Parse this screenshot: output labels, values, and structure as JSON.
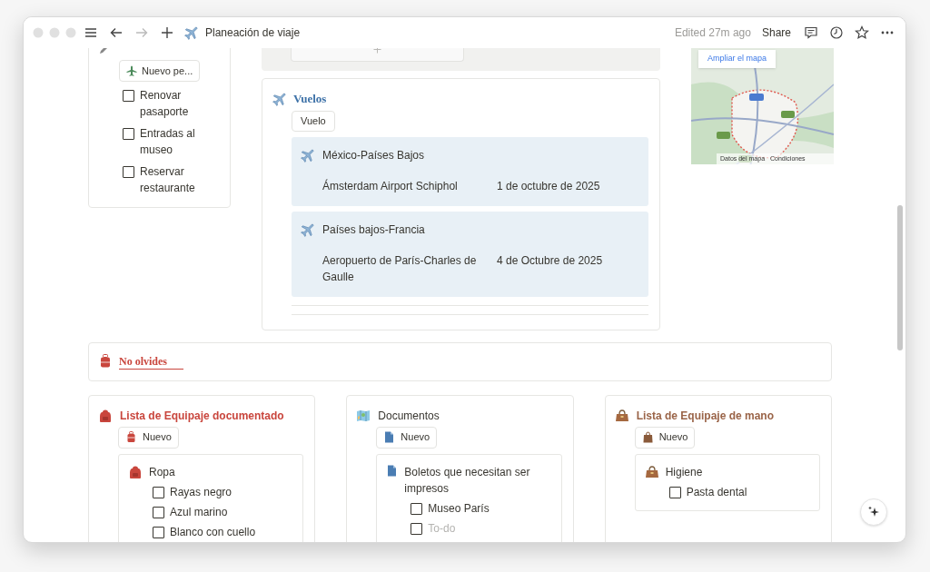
{
  "topbar": {
    "title": "Planeación de viaje",
    "edited": "Edited 27m ago",
    "share": "Share"
  },
  "pending": {
    "button": "Nuevo pe...",
    "todos": [
      {
        "text": "Renovar pasaporte",
        "checked": false
      },
      {
        "text": "Entradas al museo",
        "checked": false
      },
      {
        "text": "Reservar restaurante",
        "checked": false
      }
    ]
  },
  "flights": {
    "title": "Vuelos",
    "button": "Vuelo",
    "items": [
      {
        "title": "México-Países Bajos",
        "airport": "Ámsterdam Airport Schiphol",
        "date": "1 de octubre de 2025"
      },
      {
        "title": "Países bajos-Francia",
        "airport": "Aeropuerto de París-Charles de Gaulle",
        "date": "4 de Octubre de 2025"
      }
    ]
  },
  "map": {
    "kind": "picture",
    "expand_link": "Ampliar el mapa",
    "attribution": [
      "Datos del mapa",
      "Condiciones"
    ]
  },
  "reminder": {
    "title": "No olvides"
  },
  "lists": [
    {
      "kind": "luggage",
      "title": "Lista de Equipaje documentado",
      "color": "#c9463d",
      "button": "Nuevo",
      "groups": [
        {
          "title": "Ropa",
          "todos": [
            {
              "text": "Rayas negro",
              "checked": false
            },
            {
              "text": "Azul marino",
              "checked": false
            },
            {
              "text": "Blanco con cuello",
              "checked": false
            }
          ]
        }
      ]
    },
    {
      "kind": "documents",
      "title": "Documentos",
      "color": "#37352f",
      "button": "Nuevo",
      "groups": [
        {
          "title": "Boletos que necesitan ser impresos",
          "todos": [
            {
              "text": "Museo París",
              "checked": false
            },
            {
              "placeholder": "To-do",
              "checked": false
            }
          ]
        }
      ]
    },
    {
      "kind": "handbag",
      "title": "Lista de Equipaje de mano",
      "color": "#9a6448",
      "button": "Nuevo",
      "groups": [
        {
          "title": "Higiene",
          "todos": [
            {
              "text": "Pasta dental",
              "checked": false
            }
          ]
        }
      ]
    }
  ]
}
